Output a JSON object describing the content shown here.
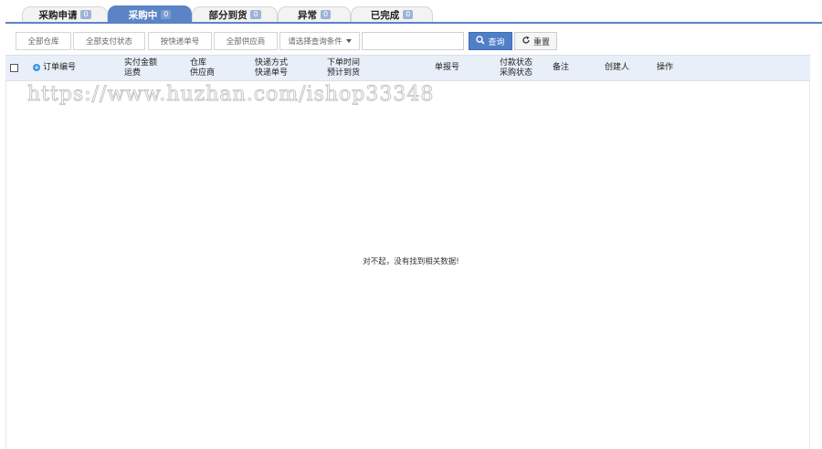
{
  "tabs": [
    {
      "label": "采购申请",
      "count": "0",
      "active": false
    },
    {
      "label": "采购中",
      "count": "0",
      "active": true
    },
    {
      "label": "部分到货",
      "count": "0",
      "active": false
    },
    {
      "label": "异常",
      "count": "0",
      "active": false
    },
    {
      "label": "已完成",
      "count": "0",
      "active": false
    }
  ],
  "filters": {
    "warehouse": "全部仓库",
    "payment_status": "全部支付状态",
    "express_no": "按快递单号",
    "supplier": "全部供应商",
    "query_condition": "请选择查询条件",
    "search_value": ""
  },
  "buttons": {
    "search": "查询",
    "reset": "重置"
  },
  "columns": {
    "order_no": "订单编号",
    "amount": "实付金额",
    "freight": "运费",
    "warehouse": "仓库",
    "supplier": "供应商",
    "express_method": "快递方式",
    "express_no": "快递单号",
    "order_time": "下单时间",
    "expected_arrival": "预计到货",
    "report_no": "单报号",
    "payment_status": "付款状态",
    "purchase_status": "采购状态",
    "remark": "备注",
    "creator": "创建人",
    "action": "操作"
  },
  "empty_message": "对不起，没有找到相关数据!",
  "watermark": "https://www.huzhan.com/ishop33348",
  "colors": {
    "accent": "#5b84c6",
    "header_bg": "#e9eff8",
    "search_btn": "#4f7fc7"
  }
}
